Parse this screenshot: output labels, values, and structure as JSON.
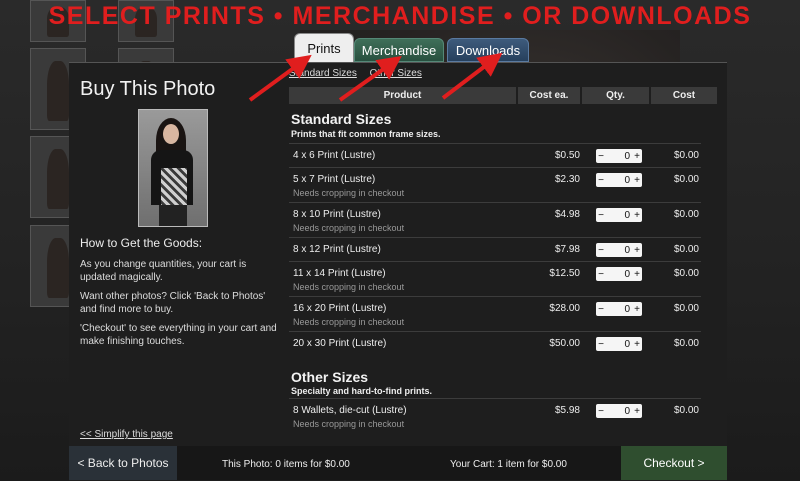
{
  "banner": "SELECT PRINTS • MERCHANDISE • OR DOWNLOADS",
  "tabs": [
    {
      "label": "Prints"
    },
    {
      "label": "Merchandise"
    },
    {
      "label": "Downloads"
    }
  ],
  "left": {
    "title": "Buy This Photo",
    "howto_heading": "How to Get the Goods:",
    "help": [
      "As you change quantities, your cart is updated magically.",
      "Want other photos? Click 'Back to Photos' and find more to buy.",
      "'Checkout' to see everything in your cart and make finishing touches."
    ],
    "simplify_link": "<< Simplify this page"
  },
  "size_links": [
    "Standard Sizes",
    "Other Sizes"
  ],
  "table_headers": [
    "Product",
    "Cost ea.",
    "Qty.",
    "Cost"
  ],
  "standard": {
    "title": "Standard Sizes",
    "subtitle": "Prints that fit common frame sizes.",
    "rows": [
      {
        "name": "4 x 6 Print (Lustre)",
        "note": "",
        "price": "$0.50",
        "qty": "0",
        "cost": "$0.00"
      },
      {
        "name": "5 x 7 Print (Lustre)",
        "note": "Needs cropping in checkout",
        "price": "$2.30",
        "qty": "0",
        "cost": "$0.00"
      },
      {
        "name": "8 x 10 Print (Lustre)",
        "note": "Needs cropping in checkout",
        "price": "$4.98",
        "qty": "0",
        "cost": "$0.00"
      },
      {
        "name": "8 x 12 Print (Lustre)",
        "note": "",
        "price": "$7.98",
        "qty": "0",
        "cost": "$0.00"
      },
      {
        "name": "11 x 14 Print (Lustre)",
        "note": "Needs cropping in checkout",
        "price": "$12.50",
        "qty": "0",
        "cost": "$0.00"
      },
      {
        "name": "16 x 20 Print (Lustre)",
        "note": "Needs cropping in checkout",
        "price": "$28.00",
        "qty": "0",
        "cost": "$0.00"
      },
      {
        "name": "20 x 30 Print (Lustre)",
        "note": "",
        "price": "$50.00",
        "qty": "0",
        "cost": "$0.00"
      }
    ]
  },
  "other": {
    "title": "Other Sizes",
    "subtitle": "Specialty and hard-to-find prints.",
    "rows": [
      {
        "name": "8 Wallets, die-cut (Lustre)",
        "note": "Needs cropping in checkout",
        "price": "$5.98",
        "qty": "0",
        "cost": "$0.00"
      }
    ]
  },
  "qty_minus": "−",
  "qty_plus": "+",
  "bottom": {
    "back": "< Back to Photos",
    "this_photo": "This Photo: 0 items for $0.00",
    "your_cart": "Your Cart: 1 item for $0.00",
    "checkout": "Checkout >"
  },
  "colors": {
    "banner": "#e01e1e",
    "arrows": "#e01e1e",
    "checkout": "#2f4e2f"
  }
}
